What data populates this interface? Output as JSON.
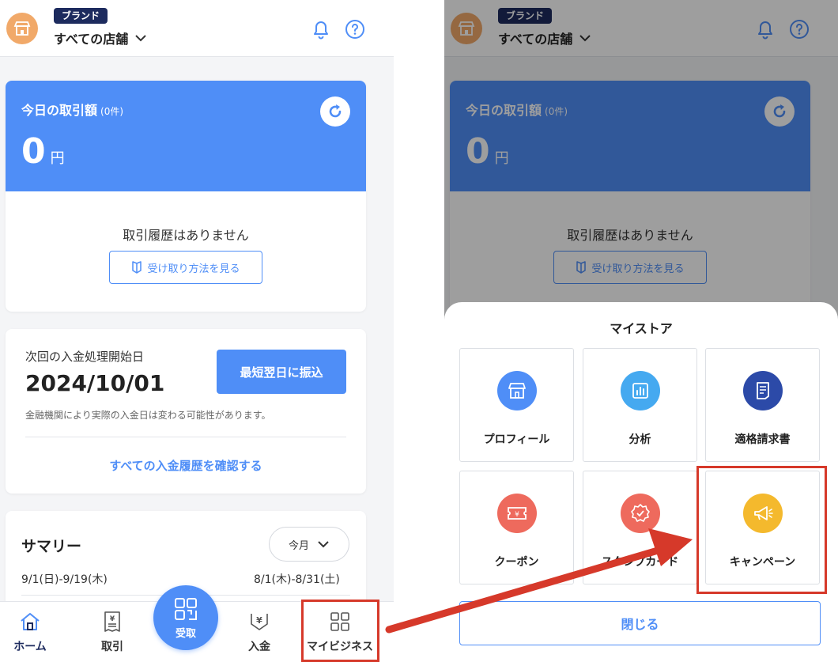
{
  "header": {
    "brand_tag": "ブランド",
    "store_selector": "すべての店舗"
  },
  "today": {
    "label": "今日の取引額",
    "count": "(0件)",
    "amount": "0",
    "unit": "円",
    "empty_text": "取引履歴はありません",
    "how_button": "受け取り方法を見る"
  },
  "deposit": {
    "label": "次回の入金処理開始日",
    "date": "2024/10/01",
    "button": "最短翌日に振込",
    "note": "金融機関により実際の入金日は変わる可能性があります。",
    "history_link": "すべての入金履歴を確認する"
  },
  "summary": {
    "title": "サマリー",
    "period": "今月",
    "current_range": "9/1(日)-9/19(木)",
    "previous_range": "8/1(木)-8/31(土)"
  },
  "nav": {
    "home": "ホーム",
    "transactions": "取引",
    "receive": "受取",
    "deposit": "入金",
    "my_business": "マイビジネス"
  },
  "sheet": {
    "title": "マイストア",
    "tiles": [
      {
        "label": "プロフィール",
        "icon": "store-icon",
        "color": "#4f8ef7"
      },
      {
        "label": "分析",
        "icon": "chart-icon",
        "color": "#45a9f0"
      },
      {
        "label": "適格請求書",
        "icon": "invoice-icon",
        "color": "#2c4aa8"
      },
      {
        "label": "クーポン",
        "icon": "coupon-icon",
        "color": "#ee6a5d"
      },
      {
        "label": "スタンプカード",
        "icon": "stamp-icon",
        "color": "#ee6a5d"
      },
      {
        "label": "キャンペーン",
        "icon": "megaphone-icon",
        "color": "#f4b92d"
      }
    ],
    "close_button": "閉じる"
  },
  "colors": {
    "primary": "#4f8ef7",
    "navy": "#1d2b5e",
    "highlight": "#d6392a",
    "avatar": "#f1a969"
  }
}
